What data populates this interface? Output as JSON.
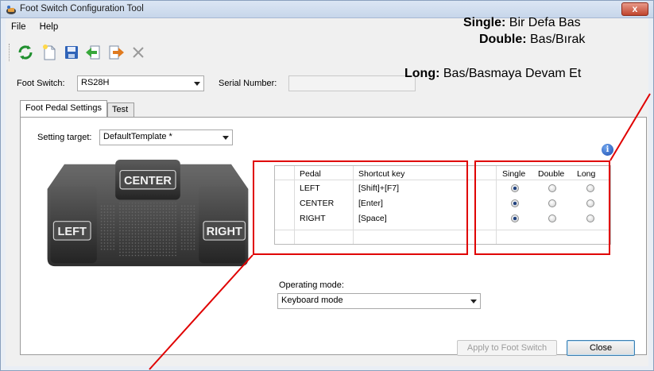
{
  "window": {
    "title": "Foot Switch Configuration Tool",
    "close_glyph": "x"
  },
  "menu": {
    "file": "File",
    "help": "Help"
  },
  "toolbar": {
    "refresh": "refresh-icon",
    "new": "new-file-icon",
    "save": "save-icon",
    "import": "import-icon",
    "export": "export-icon",
    "delete": "delete-icon"
  },
  "foot_switch": {
    "label": "Foot Switch:",
    "value": "RS28H"
  },
  "serial": {
    "label": "Serial Number:",
    "value": ""
  },
  "tabs": {
    "settings": "Foot Pedal Settings",
    "test": "Test"
  },
  "setting_target": {
    "label": "Setting target:",
    "value": "DefaultTemplate *"
  },
  "pedal_image": {
    "center": "CENTER",
    "left": "LEFT",
    "right": "RIGHT"
  },
  "table": {
    "headers": {
      "pedal": "Pedal",
      "shortcut": "Shortcut key",
      "single": "Single",
      "double": "Double",
      "long": "Long"
    },
    "rows": [
      {
        "pedal": "LEFT",
        "shortcut": "[Shift]+[F7]",
        "mode": "single"
      },
      {
        "pedal": "CENTER",
        "shortcut": "[Enter]",
        "mode": "single"
      },
      {
        "pedal": "RIGHT",
        "shortcut": "[Space]",
        "mode": "single"
      }
    ]
  },
  "operating_mode": {
    "label": "Operating mode:",
    "value": "Keyboard mode"
  },
  "buttons": {
    "apply": "Apply to Foot Switch",
    "close": "Close"
  },
  "annotations": {
    "single_key": "Single:",
    "single_text": " Bir Defa Bas",
    "double_key": "Double:",
    "double_text": " Bas/Bırak",
    "long_key": "Long:",
    "long_text": " Bas/Basmaya Devam Et"
  },
  "colors": {
    "annotation_red": "#e00000",
    "titlebar": "#c7d6ea",
    "window_bg": "#f0f0f0"
  }
}
